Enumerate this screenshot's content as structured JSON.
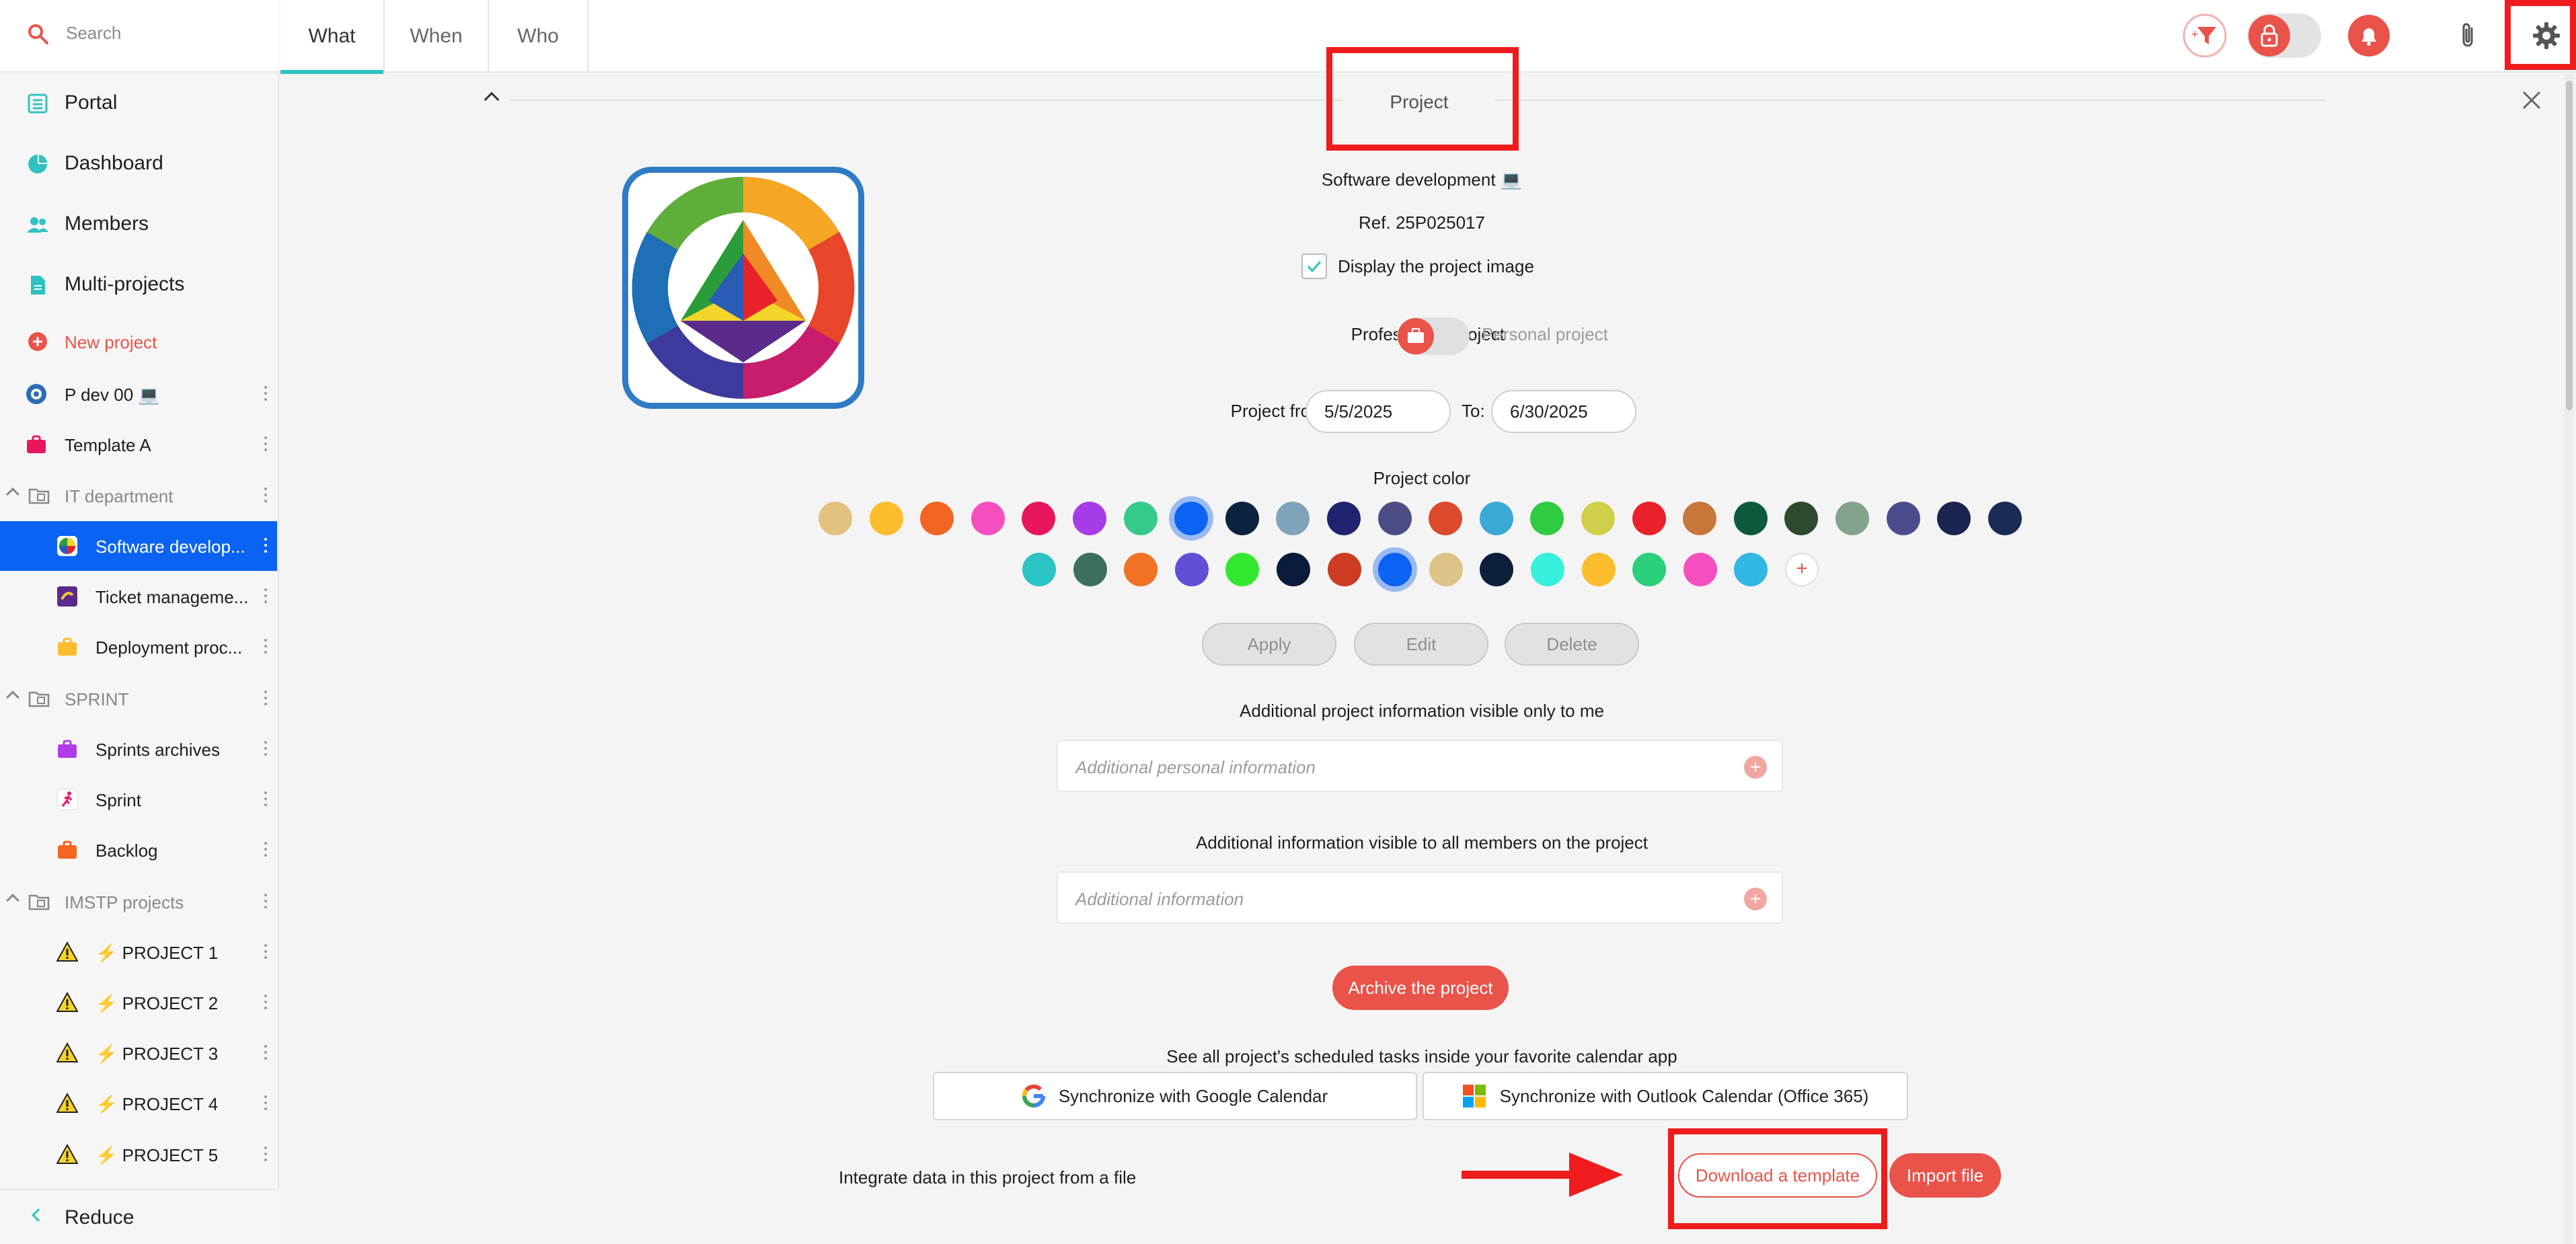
{
  "search": {
    "placeholder": "Search"
  },
  "sidebar": {
    "top": [
      {
        "label": "Portal",
        "icon": "list-icon"
      },
      {
        "label": "Dashboard",
        "icon": "pie-chart-icon"
      },
      {
        "label": "Members",
        "icon": "users-icon"
      },
      {
        "label": "Multi-projects",
        "icon": "document-icon"
      }
    ],
    "new_project": "New project",
    "items": [
      {
        "label": "P dev 00 💻",
        "icon": "project-avatar-icon"
      },
      {
        "label": "Template A",
        "icon": "briefcase-icon"
      },
      {
        "label": "IT department",
        "icon": "folder-icon",
        "group": true
      },
      {
        "label": "Software develop...",
        "icon": "color-wheel-icon",
        "selected": true
      },
      {
        "label": "Ticket manageme...",
        "icon": "ticket-icon"
      },
      {
        "label": "Deployment proc...",
        "icon": "briefcase-icon"
      },
      {
        "label": "SPRINT",
        "icon": "folder-icon",
        "group": true
      },
      {
        "label": "Sprints archives",
        "icon": "briefcase-icon"
      },
      {
        "label": "Sprint",
        "icon": "runner-icon"
      },
      {
        "label": "Backlog",
        "icon": "briefcase-icon"
      },
      {
        "label": "IMSTP projects",
        "icon": "folder-icon",
        "group": true
      },
      {
        "label": "⚡ PROJECT 1",
        "icon": "warning-icon"
      },
      {
        "label": "⚡ PROJECT 2",
        "icon": "warning-icon"
      },
      {
        "label": "⚡ PROJECT 3",
        "icon": "warning-icon"
      },
      {
        "label": "⚡ PROJECT 4",
        "icon": "warning-icon"
      },
      {
        "label": "⚡ PROJECT 5",
        "icon": "warning-icon"
      }
    ],
    "reduce": "Reduce"
  },
  "header": {
    "tabs": [
      "What",
      "When",
      "Who"
    ],
    "icons": [
      "filter-add-icon",
      "lock-icon",
      "bell-icon",
      "paperclip-icon",
      "gear-icon"
    ]
  },
  "project": {
    "section_title": "Project",
    "name": "Software development 💻",
    "ref": "Ref. 25P025017",
    "display_image_label": "Display the project image",
    "display_image_checked": true,
    "professional_label": "Professional project",
    "personal_label": "Personal project",
    "from_label": "Project from:",
    "from_value": "5/5/2025",
    "to_label": "To:",
    "to_value": "6/30/2025",
    "color_label": "Project color",
    "colors_row1": [
      "#e2c27e",
      "#fbbd2e",
      "#f26522",
      "#f54fbf",
      "#e8175d",
      "#a63be8",
      "#35c98a",
      "#0b62f3",
      "#0c2340",
      "#7fa3b8",
      "#1f2370",
      "#4d4d86",
      "#db4a2b",
      "#3aa9d6",
      "#2ecc40",
      "#cfcf4a",
      "#e8212a",
      "#c8773a",
      "#0d5a3a",
      "#2b4a2e",
      "#82a38c",
      "#4c4c8c",
      "#1a2450",
      "#182b55"
    ],
    "colors_row2": [
      "#2bc3c3",
      "#3d6f5e",
      "#f07224",
      "#5e4fd6",
      "#34e82f",
      "#0a1a3a",
      "#cc3b22",
      "#0b62f3",
      "#dcc487",
      "#0e1f3b",
      "#37f0dd",
      "#fbbd2e",
      "#2cd07a",
      "#f54fbf",
      "#32b8e2"
    ],
    "selected_color_row1": 7,
    "selected_color_row2": 7,
    "apply": "Apply",
    "edit": "Edit",
    "delete": "Delete",
    "private_info_label": "Additional project information visible only to me",
    "private_info_placeholder": "Additional personal information",
    "shared_info_label": "Additional information visible to all members on the project",
    "shared_info_placeholder": "Additional information",
    "archive": "Archive the project",
    "calendar_label": "See all project's scheduled tasks inside your favorite calendar app",
    "google_sync": "Synchronize with Google Calendar",
    "outlook_sync": "Synchronize with Outlook Calendar (Office 365)",
    "integrate_label": "Integrate data in this project from a file",
    "download_template": "Download a template",
    "import_file": "Import file"
  },
  "colors": {
    "accent_teal": "#2fc2c2",
    "accent_red": "#e9534a",
    "selection_blue": "#0b63f3",
    "annotation_red": "#ee1c1c"
  }
}
